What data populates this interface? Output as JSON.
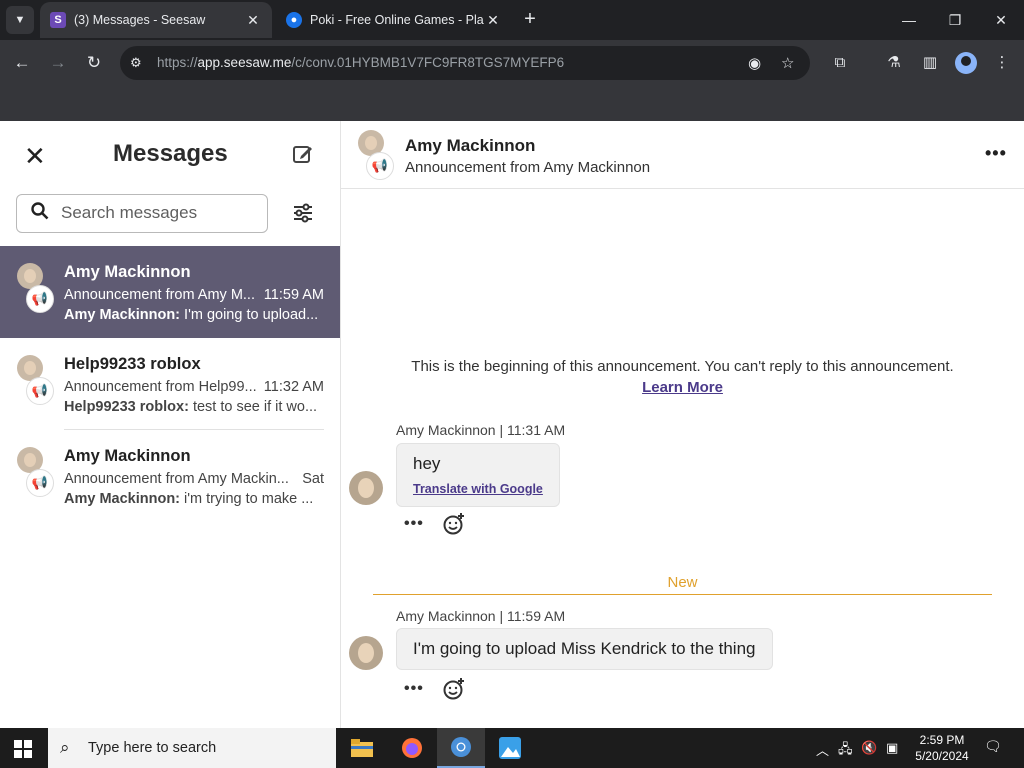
{
  "browser": {
    "tabs": [
      {
        "title": "(3) Messages - Seesaw",
        "favicon": "seesaw-icon",
        "active": true
      },
      {
        "title": "Poki - Free Online Games - Pla",
        "favicon": "poki-icon",
        "active": false
      }
    ],
    "url_scheme": "https://",
    "url_host": "app.seesaw.me",
    "url_path": "/c/conv.01HYBMB1V7FC9FR8TGS7MYEFP6"
  },
  "sidebar": {
    "title": "Messages",
    "search_placeholder": "Search messages",
    "conversations": [
      {
        "name": "Amy Mackinnon",
        "subtitle": "Announcement from Amy M...",
        "time": "11:59 AM",
        "preview_sender": "Amy Mackinnon:",
        "preview_text": " I'm going to upload...",
        "selected": true
      },
      {
        "name": "Help99233 roblox",
        "subtitle": "Announcement from Help99...",
        "time": "11:32 AM",
        "preview_sender": "Help99233 roblox:",
        "preview_text": " test to see if it wo...",
        "selected": false
      },
      {
        "name": "Amy Mackinnon",
        "subtitle": "Announcement from Amy Mackin...",
        "time": "Sat",
        "preview_sender": "Amy Mackinnon:",
        "preview_text": " i'm trying to make ...",
        "selected": false
      }
    ]
  },
  "conversation": {
    "title": "Amy Mackinnon",
    "subtitle": "Announcement from Amy Mackinnon",
    "beginning_text": "This is the beginning of this announcement. You can't reply to this announcement.",
    "learn_more": "Learn More",
    "new_label": "New",
    "messages": [
      {
        "meta": "Amy Mackinnon | 11:31 AM",
        "text": "hey",
        "translate": "Translate with Google"
      },
      {
        "meta": "Amy Mackinnon | 11:59 AM",
        "text": "I'm going to upload Miss Kendrick to the thing"
      }
    ]
  },
  "taskbar": {
    "search_placeholder": "Type here to search",
    "time": "2:59 PM",
    "date": "5/20/2024"
  }
}
